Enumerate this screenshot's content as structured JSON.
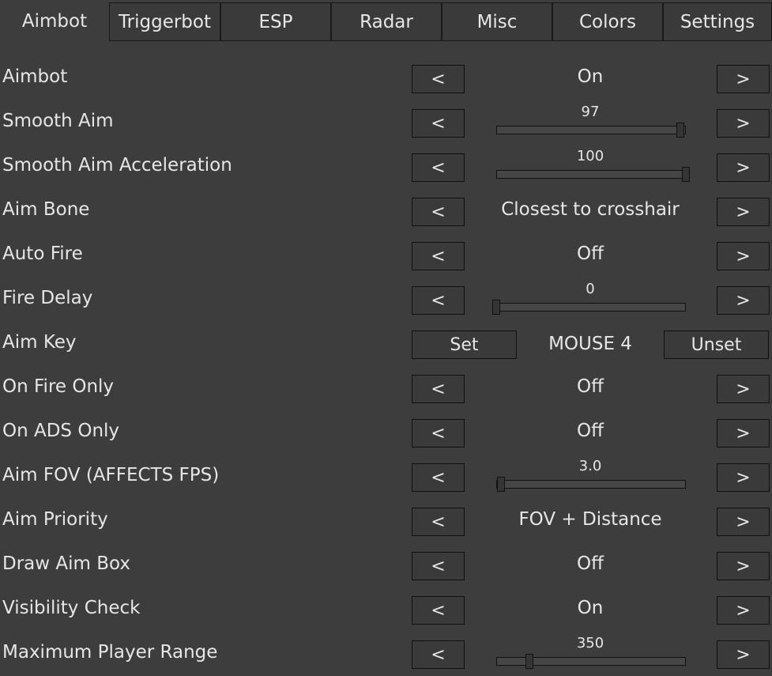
{
  "tabs": [
    {
      "label": "Aimbot",
      "active": true
    },
    {
      "label": "Triggerbot",
      "active": false
    },
    {
      "label": "ESP",
      "active": false
    },
    {
      "label": "Radar",
      "active": false
    },
    {
      "label": "Misc",
      "active": false
    },
    {
      "label": "Colors",
      "active": false
    },
    {
      "label": "Settings",
      "active": false
    }
  ],
  "arrows": {
    "left": "<",
    "right": ">"
  },
  "rows": [
    {
      "label": "Aimbot",
      "kind": "toggle",
      "value": "On"
    },
    {
      "label": "Smooth Aim",
      "kind": "slider",
      "value": "97",
      "level": 0.97
    },
    {
      "label": "Smooth Aim Acceleration",
      "kind": "slider",
      "value": "100",
      "level": 1.0
    },
    {
      "label": "Aim Bone",
      "kind": "toggle",
      "value": "Closest to crosshair"
    },
    {
      "label": "Auto Fire",
      "kind": "toggle",
      "value": "Off"
    },
    {
      "label": "Fire Delay",
      "kind": "slider",
      "value": "0",
      "level": 0.0
    },
    {
      "label": "Aim Key",
      "kind": "key",
      "value": "MOUSE 4",
      "set_label": "Set",
      "unset_label": "Unset"
    },
    {
      "label": "On Fire Only",
      "kind": "toggle",
      "value": "Off"
    },
    {
      "label": "On ADS Only",
      "kind": "toggle",
      "value": "Off"
    },
    {
      "label": "Aim FOV (AFFECTS FPS)",
      "kind": "slider",
      "value": "3.0",
      "level": 0.025
    },
    {
      "label": "Aim Priority",
      "kind": "toggle",
      "value": "FOV + Distance"
    },
    {
      "label": "Draw Aim Box",
      "kind": "toggle",
      "value": "Off"
    },
    {
      "label": "Visibility Check",
      "kind": "toggle",
      "value": "On"
    },
    {
      "label": "Maximum Player Range",
      "kind": "slider",
      "value": "350",
      "level": 0.175
    }
  ]
}
